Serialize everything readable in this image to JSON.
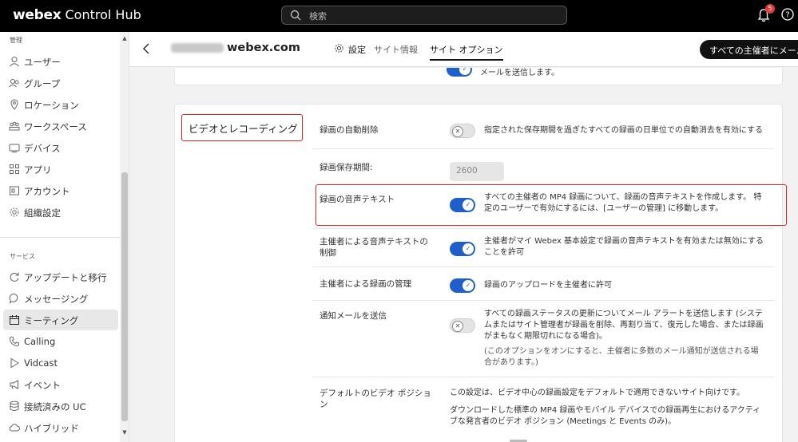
{
  "app": {
    "brand_bold": "webex",
    "brand_rest": "Control Hub"
  },
  "search": {
    "placeholder": "検索"
  },
  "notifications": {
    "count": "5"
  },
  "sidebar": {
    "section_manage": "管理",
    "manage_items": [
      {
        "label": "ユーザー",
        "icon": "user-icon"
      },
      {
        "label": "グループ",
        "icon": "group-icon"
      },
      {
        "label": "ロケーション",
        "icon": "location-pin-icon"
      },
      {
        "label": "ワークスペース",
        "icon": "workspace-icon"
      },
      {
        "label": "デバイス",
        "icon": "device-icon"
      },
      {
        "label": "アプリ",
        "icon": "apps-grid-icon"
      },
      {
        "label": "アカウント",
        "icon": "account-icon"
      },
      {
        "label": "組織設定",
        "icon": "gear-icon"
      }
    ],
    "section_services": "サービス",
    "service_items": [
      {
        "label": "アップデートと移行",
        "icon": "refresh-icon"
      },
      {
        "label": "メッセージング",
        "icon": "chat-icon"
      },
      {
        "label": "ミーティング",
        "icon": "calendar-icon",
        "active": true
      },
      {
        "label": "Calling",
        "icon": "phone-icon"
      },
      {
        "label": "Vidcast",
        "icon": "play-icon"
      },
      {
        "label": "イベント",
        "icon": "megaphone-icon"
      },
      {
        "label": "接続済みの UC",
        "icon": "database-icon"
      },
      {
        "label": "ハイブリッド",
        "icon": "cloud-icon"
      }
    ]
  },
  "header": {
    "site_domain": "webex.com",
    "tabs": {
      "settings": "設定",
      "site_info": "サイト情報",
      "site_options": "サイト オプション"
    },
    "action_button": "すべての主催者にメール"
  },
  "top_card": {
    "text": "メールを送信します。"
  },
  "section": {
    "title": "ビデオとレコーディング",
    "rows": {
      "auto_delete": {
        "label": "録画の自動削除",
        "desc": "指定された保存期間を過ぎたすべての録画の日単位での自動消去を有効にする"
      },
      "retention": {
        "label": "録画保存期間:",
        "value": "2600"
      },
      "transcript": {
        "label": "録画の音声テキスト",
        "desc1": "すべての主催者の MP4 録画について、録画の音声テキストを作成します。 特",
        "desc2": "定のユーザーで有効にするには、[ユーザーの管理] に移動します。"
      },
      "host_transcript": {
        "label1": "主催者による音声テキストの",
        "label2": "制御",
        "desc1": "主催者がマイ Webex 基本設定で録画の音声テキストを有効または無効にする",
        "desc2": "ことを許可"
      },
      "host_recording": {
        "label": "主催者による録画の管理",
        "desc": "録画のアップロードを主催者に許可"
      },
      "notify": {
        "label": "通知メールを送信",
        "desc1": "すべての録画ステータスの更新についてメール アラートを送信します (システ",
        "desc2": "ムまたはサイト管理者が録画を削除、再割り当て、復元した場合、または録画",
        "desc3": "がまもなく期限切れになる場合)。",
        "note1": "(このオプションをオンにすると、主催者に多数のメール通知が送信される場",
        "note2": "合があります。)"
      },
      "video_position": {
        "label1": "デフォルトのビデオ ポジショ",
        "label2": "ン",
        "desc1": "この設定は、ビデオ中心の録画設定をデフォルトで適用できないサイト向けです。",
        "desc2": "ダウンロードした標準の MP4 録画やモバイル デバイスでの録画再生におけるアクティ",
        "desc3": "ブな発言者のビデオ ポジション (Meetings と Events のみ)。"
      }
    }
  },
  "toggles": {
    "top_card": true,
    "auto_delete": false,
    "transcript": true,
    "host_transcript": true,
    "host_recording": true,
    "notify": false
  }
}
